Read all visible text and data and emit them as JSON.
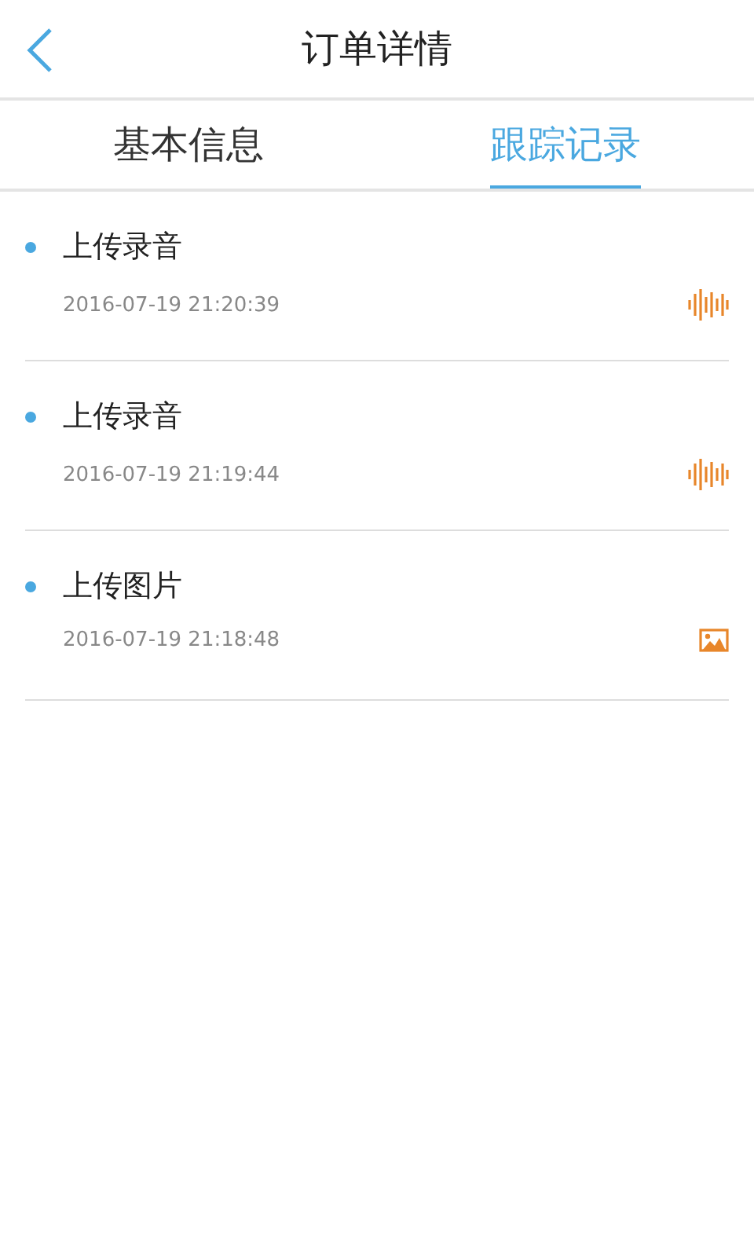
{
  "header": {
    "title": "订单详情"
  },
  "tabs": [
    {
      "label": "基本信息",
      "selected": false
    },
    {
      "label": "跟踪记录",
      "selected": true
    }
  ],
  "records": [
    {
      "title": "上传录音",
      "time": "2016-07-19 21:20:39",
      "kind": "audio"
    },
    {
      "title": "上传录音",
      "time": "2016-07-19 21:19:44",
      "kind": "audio"
    },
    {
      "title": "上传图片",
      "time": "2016-07-19 21:18:48",
      "kind": "image"
    }
  ]
}
